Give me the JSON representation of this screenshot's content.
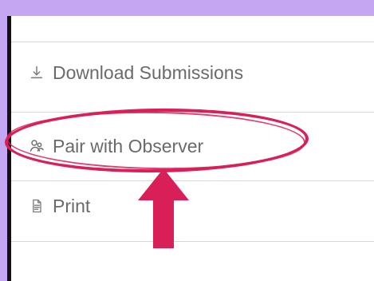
{
  "menu": {
    "download_label": "Download Submissions",
    "pair_label": "Pair with Observer",
    "print_label": "Print"
  },
  "icons": {
    "download": "download-icon",
    "pair": "user-pair-icon",
    "print": "document-icon"
  },
  "colors": {
    "background": "#c5a6f2",
    "highlight": "#d91f58",
    "text": "#6a6a6a",
    "divider": "#d7d7d7"
  }
}
